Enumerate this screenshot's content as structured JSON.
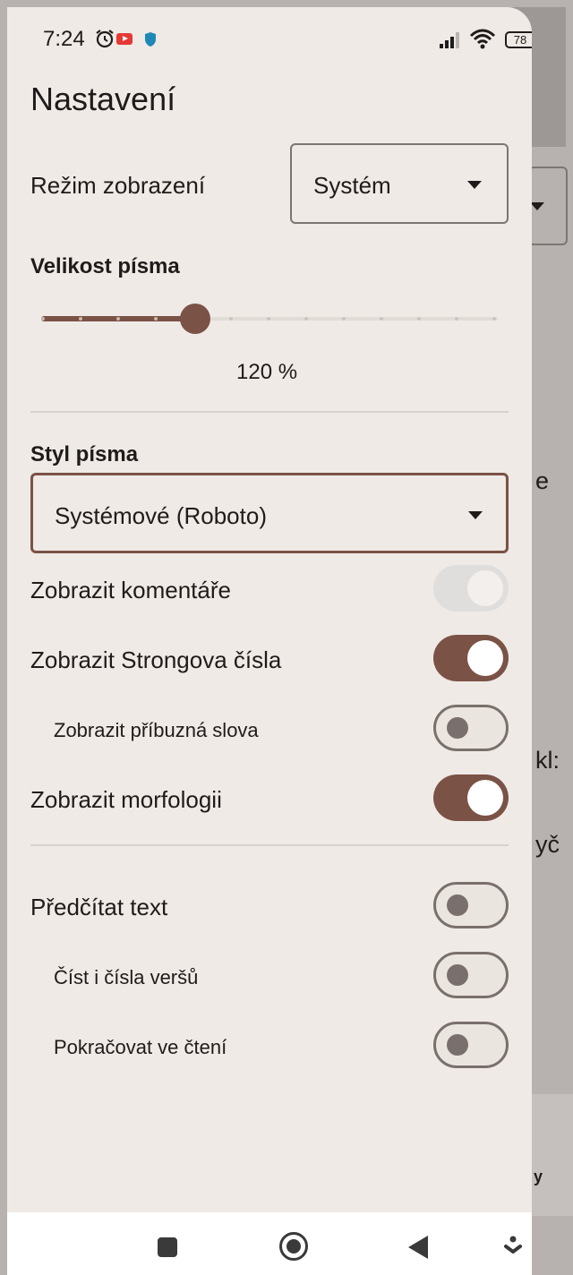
{
  "status_bar": {
    "time": "7:24",
    "battery": "78",
    "icons": [
      "alarm-icon",
      "youtube-icon",
      "shield-icon",
      "signal-icon",
      "wifi-icon",
      "battery-icon"
    ]
  },
  "drawer": {
    "title": "Nastavení",
    "display_mode": {
      "label": "Režim zobrazení",
      "value": "Systém"
    },
    "font_size": {
      "label": "Velikost písma",
      "value_text": "120 %",
      "value_percent": 120,
      "steps": 12,
      "selected_step": 4
    },
    "font_style": {
      "label": "Styl písma",
      "value": "Systémové (Roboto)"
    },
    "toggles": [
      {
        "label": "Zobrazit komentáře",
        "state": "on-disabled",
        "indent": false
      },
      {
        "label": "Zobrazit Strongova čísla",
        "state": "on",
        "indent": false
      },
      {
        "label": "Zobrazit příbuzná slova",
        "state": "off",
        "indent": true
      },
      {
        "label": "Zobrazit morfologii",
        "state": "on",
        "indent": false
      }
    ],
    "tts_toggles": [
      {
        "label": "Předčítat text",
        "state": "off",
        "indent": false
      },
      {
        "label": "Číst i čísla veršů",
        "state": "off",
        "indent": true
      },
      {
        "label": "Pokračovat ve čtení",
        "state": "off",
        "indent": true
      }
    ]
  },
  "background": {
    "fragments": [
      "e",
      "kl:",
      "yč",
      "y"
    ]
  },
  "colors": {
    "accent": "#7b5246",
    "surface": "#efeae6",
    "outline": "#79706d"
  }
}
